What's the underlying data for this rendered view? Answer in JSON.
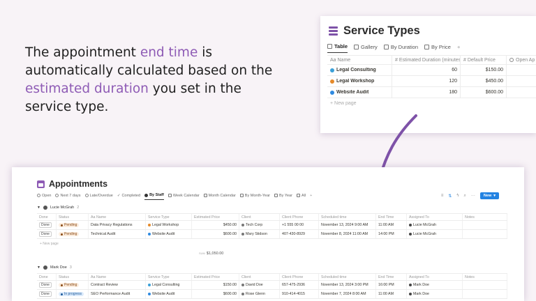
{
  "headline": {
    "part1": "The  appointment ",
    "hl1": "end time",
    "part2": " is automatically calculated based on the ",
    "hl2": "estimated duration",
    "part3": " you set in the service type."
  },
  "colors": {
    "accent": "#8e5bb5",
    "background": "#f8f3f7",
    "button": "#2383e2"
  },
  "service_types": {
    "title": "Service Types",
    "tabs": [
      {
        "label": "Table",
        "icon": "table-icon"
      },
      {
        "label": "Gallery",
        "icon": "gallery-icon"
      },
      {
        "label": "By Duration",
        "icon": "list-icon"
      },
      {
        "label": "By Price",
        "icon": "board-icon"
      }
    ],
    "columns": {
      "name": "Aa Name",
      "duration": "# Estimated Duration (minutes)",
      "price": "# Default Price",
      "open": "Open Ap"
    },
    "rows": [
      {
        "name": "Legal Consulting",
        "duration": "60",
        "price": "$150.00",
        "dot": "#3aa0d8"
      },
      {
        "name": "Legal Workshop",
        "duration": "120",
        "price": "$450.00",
        "dot": "#e58a2a"
      },
      {
        "name": "Website Audit",
        "duration": "180",
        "price": "$600.00",
        "dot": "#2f8ae0"
      }
    ],
    "new_page": "+ New page"
  },
  "appointments": {
    "title": "Appointments",
    "tabs": [
      "Open",
      "Next 7 days",
      "Late/Overdue",
      "Completed",
      "By Staff",
      "Week Calendar",
      "Month Calendar",
      "By Month-Year",
      "By Year",
      "All"
    ],
    "active_tab": "By Staff",
    "new_button": "New",
    "columns": {
      "done": "Done",
      "status": "Status",
      "name": "Aa Name",
      "type": "Service Type",
      "price": "Estimated Price",
      "client": "Client",
      "phone": "Client Phone",
      "sched": "Scheduled time",
      "end": "End Time",
      "assign": "Assigned To",
      "notes": "Notes"
    },
    "groups": [
      {
        "name": "Lucie McGrah",
        "count": "2",
        "rows": [
          {
            "done": "Done",
            "status": "Pending",
            "name": "Data Privacy Regulations",
            "type": "Legal Workshop",
            "price": "$450.00",
            "client": "Tech Corp",
            "phone": "+1 555 00 00",
            "sched": "November 13, 2024 9:00 AM",
            "end": "11:00 AM",
            "assign": "Lucie McGrah"
          },
          {
            "done": "Done",
            "status": "Pending",
            "name": "Technical Audit",
            "type": "Website Audit",
            "price": "$600.00",
            "client": "Mary Stidson",
            "phone": "407-430-8929",
            "sched": "November 8, 2024 11:00 AM",
            "end": "14:00 PM",
            "assign": "Lucie McGrah"
          }
        ],
        "new_page": "+ New page",
        "sum_label": "SUM",
        "sum": "$1,050.00"
      },
      {
        "name": "Mark Doe",
        "count": "3",
        "rows": [
          {
            "done": "Done",
            "status": "Pending",
            "name": "Contract Review",
            "type": "Legal Consulting",
            "price": "$150.00",
            "client": "David Doe",
            "phone": "657-475-2936",
            "sched": "November 13, 2024 3:00 PM",
            "end": "16:00 PM",
            "assign": "Mark Doe"
          },
          {
            "done": "Done",
            "status": "In progress",
            "name": "SEO Performance Audit",
            "type": "Website Audit",
            "price": "$600.00",
            "client": "Rose Glenn",
            "phone": "910-414-4015",
            "sched": "November 7, 2024 8:00 AM",
            "end": "11:00 AM",
            "assign": "Mark Doe"
          }
        ]
      }
    ]
  }
}
